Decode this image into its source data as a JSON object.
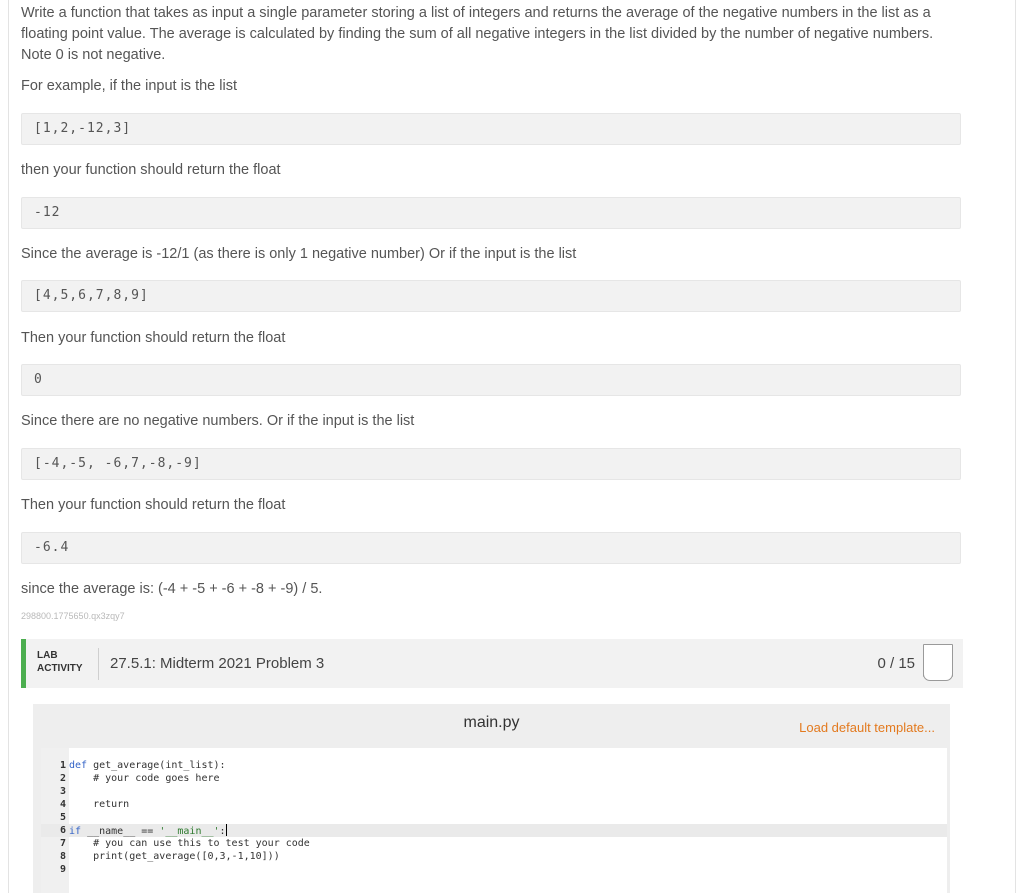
{
  "problem": {
    "intro": "Write a function that takes as input a single parameter storing a list of integers and returns the average of the negative numbers in the list as a floating point value. The average is calculated by finding the sum of all negative integers in the list divided by the number of negative numbers. Note 0 is not negative.",
    "example_intro": "For example, if the input is the list",
    "ex1_input": "[1,2,-12,3]",
    "ex1_then": "then your function should return the float",
    "ex1_output": "-12",
    "ex1_reason": "Since the average is -12/1 (as there is only 1 negative number) Or if the input is the list",
    "ex2_input": "[4,5,6,7,8,9]",
    "ex2_then": "Then your function should return the float",
    "ex2_output": "0",
    "ex2_reason": "Since there are no negative numbers. Or if the input is the list",
    "ex3_input": "[-4,-5, -6,7,-8,-9]",
    "ex3_then": "Then your function should return the float",
    "ex3_output": "-6.4",
    "ex3_reason": "since the average is: (-4 + -5 + -6 + -8 + -9) / 5.",
    "caption": "298800.1775650.qx3zqy7"
  },
  "lab": {
    "tag_line1": "LAB",
    "tag_line2": "ACTIVITY",
    "title": "27.5.1: Midterm 2021 Problem 3",
    "score": "0 / 15",
    "accent_color": "#4cae4f"
  },
  "editor": {
    "file_name": "main.py",
    "load_label": "Load default template...",
    "line_numbers": [
      "1",
      "2",
      "3",
      "4",
      "5",
      "6",
      "7",
      "8",
      "9"
    ],
    "lines": {
      "l1_kw": "def",
      "l1_rest": " get_average(int_list):",
      "l2": "    # your code goes here",
      "l3": "",
      "l4_kw": "    return",
      "l5": "",
      "l6_kw": "if",
      "l6_mid": " __name__ == ",
      "l6_str": "'__main__'",
      "l6_end": ":",
      "l7": "    # you can use this to test your code",
      "l8": "    print(get_average([0,3,-1,10]))",
      "l9": ""
    }
  }
}
